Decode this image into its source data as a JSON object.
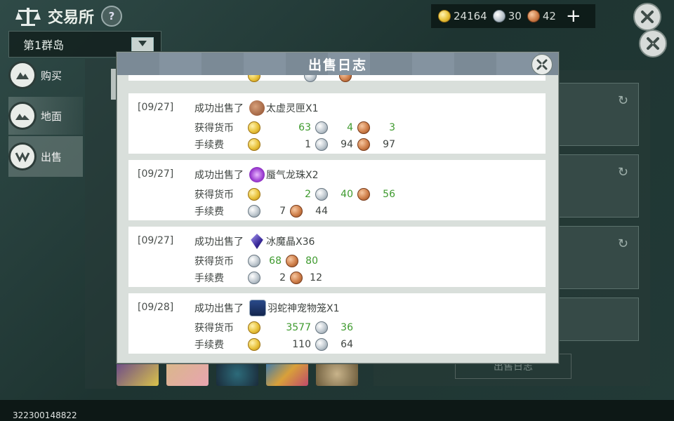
{
  "header": {
    "title": "交易所",
    "help_label": "?"
  },
  "island_selector": {
    "value": "第1群岛"
  },
  "sidebar": {
    "items": [
      {
        "label": "购买",
        "icon": "buy-icon"
      },
      {
        "label": "地面",
        "icon": "ground-icon"
      },
      {
        "label": "出售",
        "icon": "sell-icon"
      }
    ]
  },
  "currency": {
    "gold": "24164",
    "silver": "30",
    "copper": "42",
    "add_label": "+"
  },
  "background": {
    "sell_log_button": "出售日志"
  },
  "modal": {
    "title": "出售日志",
    "entries": [
      {
        "date": "[09/27]",
        "action": "成功出售了",
        "item": "太虚灵匣X1",
        "earned_label": "获得货币",
        "earned": {
          "gold": "63",
          "silver": "4",
          "copper": "3"
        },
        "fee_label": "手续费",
        "fee": {
          "gold": "1",
          "silver": "94",
          "copper": "97"
        }
      },
      {
        "date": "[09/27]",
        "action": "成功出售了",
        "item": "蜃气龙珠X2",
        "earned_label": "获得货币",
        "earned": {
          "gold": "2",
          "silver": "40",
          "copper": "56"
        },
        "fee_label": "手续费",
        "fee": {
          "silver": "7",
          "copper": "44"
        }
      },
      {
        "date": "[09/27]",
        "action": "成功出售了",
        "item": "冰魔晶X36",
        "earned_label": "获得货币",
        "earned": {
          "silver": "68",
          "copper": "80"
        },
        "fee_label": "手续费",
        "fee": {
          "silver": "2",
          "copper": "12"
        }
      },
      {
        "date": "[09/28]",
        "action": "成功出售了",
        "item": "羽蛇神宠物笼X1",
        "earned_label": "获得货币",
        "earned": {
          "gold": "3577",
          "silver": "36"
        },
        "fee_label": "手续费",
        "fee": {
          "gold": "110",
          "silver": "64"
        }
      }
    ]
  },
  "footer": {
    "player_id": "322300148822"
  },
  "colors": {
    "earned_value": "#3e9a2e",
    "modal_header": "#7b8a96",
    "panel_bg": "#d9dfdb"
  }
}
